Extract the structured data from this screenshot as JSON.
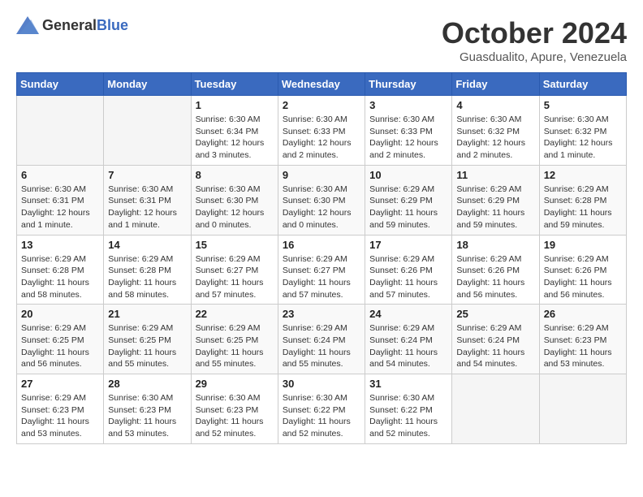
{
  "header": {
    "logo_general": "General",
    "logo_blue": "Blue",
    "month_year": "October 2024",
    "location": "Guasdualito, Apure, Venezuela"
  },
  "weekdays": [
    "Sunday",
    "Monday",
    "Tuesday",
    "Wednesday",
    "Thursday",
    "Friday",
    "Saturday"
  ],
  "weeks": [
    [
      {
        "day": "",
        "empty": true
      },
      {
        "day": "",
        "empty": true
      },
      {
        "day": "1",
        "sunrise": "Sunrise: 6:30 AM",
        "sunset": "Sunset: 6:34 PM",
        "daylight": "Daylight: 12 hours and 3 minutes."
      },
      {
        "day": "2",
        "sunrise": "Sunrise: 6:30 AM",
        "sunset": "Sunset: 6:33 PM",
        "daylight": "Daylight: 12 hours and 2 minutes."
      },
      {
        "day": "3",
        "sunrise": "Sunrise: 6:30 AM",
        "sunset": "Sunset: 6:33 PM",
        "daylight": "Daylight: 12 hours and 2 minutes."
      },
      {
        "day": "4",
        "sunrise": "Sunrise: 6:30 AM",
        "sunset": "Sunset: 6:32 PM",
        "daylight": "Daylight: 12 hours and 2 minutes."
      },
      {
        "day": "5",
        "sunrise": "Sunrise: 6:30 AM",
        "sunset": "Sunset: 6:32 PM",
        "daylight": "Daylight: 12 hours and 1 minute."
      }
    ],
    [
      {
        "day": "6",
        "sunrise": "Sunrise: 6:30 AM",
        "sunset": "Sunset: 6:31 PM",
        "daylight": "Daylight: 12 hours and 1 minute."
      },
      {
        "day": "7",
        "sunrise": "Sunrise: 6:30 AM",
        "sunset": "Sunset: 6:31 PM",
        "daylight": "Daylight: 12 hours and 1 minute."
      },
      {
        "day": "8",
        "sunrise": "Sunrise: 6:30 AM",
        "sunset": "Sunset: 6:30 PM",
        "daylight": "Daylight: 12 hours and 0 minutes."
      },
      {
        "day": "9",
        "sunrise": "Sunrise: 6:30 AM",
        "sunset": "Sunset: 6:30 PM",
        "daylight": "Daylight: 12 hours and 0 minutes."
      },
      {
        "day": "10",
        "sunrise": "Sunrise: 6:29 AM",
        "sunset": "Sunset: 6:29 PM",
        "daylight": "Daylight: 11 hours and 59 minutes."
      },
      {
        "day": "11",
        "sunrise": "Sunrise: 6:29 AM",
        "sunset": "Sunset: 6:29 PM",
        "daylight": "Daylight: 11 hours and 59 minutes."
      },
      {
        "day": "12",
        "sunrise": "Sunrise: 6:29 AM",
        "sunset": "Sunset: 6:28 PM",
        "daylight": "Daylight: 11 hours and 59 minutes."
      }
    ],
    [
      {
        "day": "13",
        "sunrise": "Sunrise: 6:29 AM",
        "sunset": "Sunset: 6:28 PM",
        "daylight": "Daylight: 11 hours and 58 minutes."
      },
      {
        "day": "14",
        "sunrise": "Sunrise: 6:29 AM",
        "sunset": "Sunset: 6:28 PM",
        "daylight": "Daylight: 11 hours and 58 minutes."
      },
      {
        "day": "15",
        "sunrise": "Sunrise: 6:29 AM",
        "sunset": "Sunset: 6:27 PM",
        "daylight": "Daylight: 11 hours and 57 minutes."
      },
      {
        "day": "16",
        "sunrise": "Sunrise: 6:29 AM",
        "sunset": "Sunset: 6:27 PM",
        "daylight": "Daylight: 11 hours and 57 minutes."
      },
      {
        "day": "17",
        "sunrise": "Sunrise: 6:29 AM",
        "sunset": "Sunset: 6:26 PM",
        "daylight": "Daylight: 11 hours and 57 minutes."
      },
      {
        "day": "18",
        "sunrise": "Sunrise: 6:29 AM",
        "sunset": "Sunset: 6:26 PM",
        "daylight": "Daylight: 11 hours and 56 minutes."
      },
      {
        "day": "19",
        "sunrise": "Sunrise: 6:29 AM",
        "sunset": "Sunset: 6:26 PM",
        "daylight": "Daylight: 11 hours and 56 minutes."
      }
    ],
    [
      {
        "day": "20",
        "sunrise": "Sunrise: 6:29 AM",
        "sunset": "Sunset: 6:25 PM",
        "daylight": "Daylight: 11 hours and 56 minutes."
      },
      {
        "day": "21",
        "sunrise": "Sunrise: 6:29 AM",
        "sunset": "Sunset: 6:25 PM",
        "daylight": "Daylight: 11 hours and 55 minutes."
      },
      {
        "day": "22",
        "sunrise": "Sunrise: 6:29 AM",
        "sunset": "Sunset: 6:25 PM",
        "daylight": "Daylight: 11 hours and 55 minutes."
      },
      {
        "day": "23",
        "sunrise": "Sunrise: 6:29 AM",
        "sunset": "Sunset: 6:24 PM",
        "daylight": "Daylight: 11 hours and 55 minutes."
      },
      {
        "day": "24",
        "sunrise": "Sunrise: 6:29 AM",
        "sunset": "Sunset: 6:24 PM",
        "daylight": "Daylight: 11 hours and 54 minutes."
      },
      {
        "day": "25",
        "sunrise": "Sunrise: 6:29 AM",
        "sunset": "Sunset: 6:24 PM",
        "daylight": "Daylight: 11 hours and 54 minutes."
      },
      {
        "day": "26",
        "sunrise": "Sunrise: 6:29 AM",
        "sunset": "Sunset: 6:23 PM",
        "daylight": "Daylight: 11 hours and 53 minutes."
      }
    ],
    [
      {
        "day": "27",
        "sunrise": "Sunrise: 6:29 AM",
        "sunset": "Sunset: 6:23 PM",
        "daylight": "Daylight: 11 hours and 53 minutes."
      },
      {
        "day": "28",
        "sunrise": "Sunrise: 6:30 AM",
        "sunset": "Sunset: 6:23 PM",
        "daylight": "Daylight: 11 hours and 53 minutes."
      },
      {
        "day": "29",
        "sunrise": "Sunrise: 6:30 AM",
        "sunset": "Sunset: 6:23 PM",
        "daylight": "Daylight: 11 hours and 52 minutes."
      },
      {
        "day": "30",
        "sunrise": "Sunrise: 6:30 AM",
        "sunset": "Sunset: 6:22 PM",
        "daylight": "Daylight: 11 hours and 52 minutes."
      },
      {
        "day": "31",
        "sunrise": "Sunrise: 6:30 AM",
        "sunset": "Sunset: 6:22 PM",
        "daylight": "Daylight: 11 hours and 52 minutes."
      },
      {
        "day": "",
        "empty": true
      },
      {
        "day": "",
        "empty": true
      }
    ]
  ]
}
